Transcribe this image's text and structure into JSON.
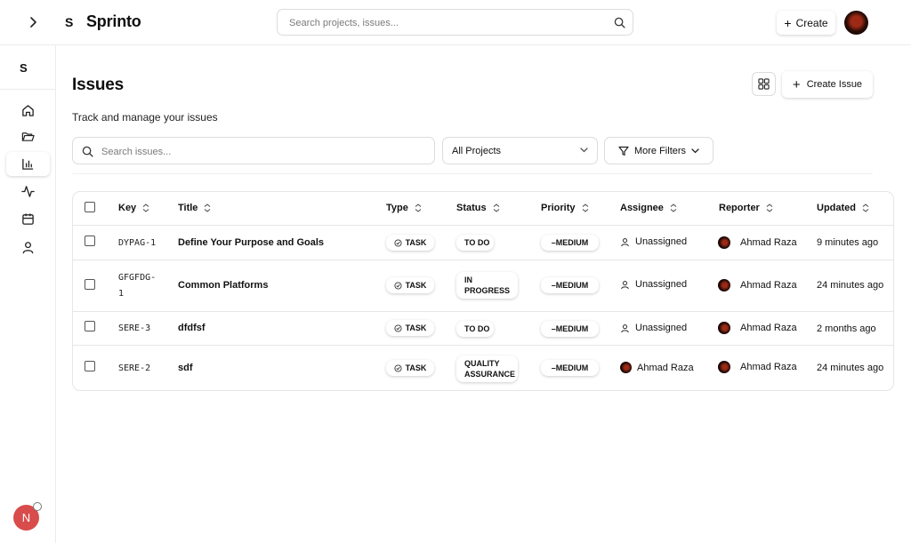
{
  "topbar": {
    "toggle_icon": "chevron-right-icon",
    "logo_letter": "S",
    "brand": "Sprinto",
    "search_placeholder": "Search projects, issues...",
    "create_label": "Create"
  },
  "sidebar": {
    "logo_letter": "S",
    "items": [
      {
        "name": "home",
        "icon": "home-icon"
      },
      {
        "name": "projects",
        "icon": "folder-icon"
      },
      {
        "name": "reports",
        "icon": "bar-chart-icon",
        "active": true
      },
      {
        "name": "activity",
        "icon": "activity-icon"
      },
      {
        "name": "calendar",
        "icon": "calendar-icon"
      },
      {
        "name": "users",
        "icon": "user-icon"
      }
    ],
    "notification_letter": "N"
  },
  "page": {
    "title": "Issues",
    "subtitle": "Track and manage your issues",
    "create_issue_label": "Create Issue"
  },
  "filters": {
    "search_placeholder": "Search issues...",
    "project_select": "All Projects",
    "more_filters": "More Filters"
  },
  "table": {
    "headers": {
      "key": "Key",
      "title": "Title",
      "type": "Type",
      "status": "Status",
      "priority": "Priority",
      "assignee": "Assignee",
      "reporter": "Reporter",
      "updated": "Updated"
    },
    "rows": [
      {
        "key": "DYPAG-1",
        "title": "Define Your Purpose and Goals",
        "type": "TASK",
        "status": "TO DO",
        "priority": "MEDIUM",
        "assignee": "Unassigned",
        "reporter": "Ahmad Raza",
        "updated": "9 minutes ago"
      },
      {
        "key": "GFGFDG-1",
        "key_line1": "GFGFDG-",
        "key_line2": "1",
        "title": "Common Platforms",
        "type": "TASK",
        "status": "IN PROGRESS",
        "status_line1": "IN",
        "status_line2": "PROGRESS",
        "priority": "MEDIUM",
        "assignee": "Unassigned",
        "reporter": "Ahmad Raza",
        "updated": "24 minutes ago"
      },
      {
        "key": "SERE-3",
        "title": "dfdfsf",
        "type": "TASK",
        "status": "TO DO",
        "priority": "MEDIUM",
        "assignee": "Unassigned",
        "reporter": "Ahmad Raza",
        "updated": "2 months ago"
      },
      {
        "key": "SERE-2",
        "title": "sdf",
        "type": "TASK",
        "status": "QUALITY ASSURANCE",
        "status_line1": "QUALITY",
        "status_line2": "ASSURANCE",
        "priority": "MEDIUM",
        "assignee": "Ahmad Raza",
        "reporter": "Ahmad Raza",
        "updated": "24 minutes ago"
      }
    ]
  }
}
